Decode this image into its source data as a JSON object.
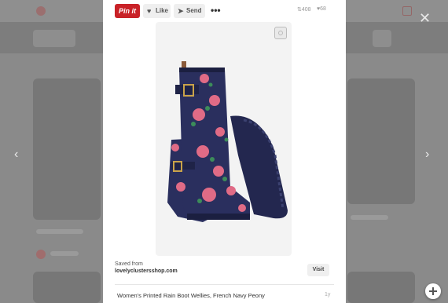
{
  "toolbar": {
    "pin_label": "Pin it",
    "like_label": "Like",
    "send_label": "Send",
    "more_label": "•••",
    "repin_count": "408",
    "like_count": "68"
  },
  "pin": {
    "saved_from_label": "Saved from",
    "domain": "lovelyclustersshop.com",
    "visit_label": "Visit",
    "description": "Women's Printed Rain Boot Wellies, French Navy Peony",
    "age": "1y"
  },
  "colors": {
    "pin_red": "#c92228",
    "boot_navy": "#2a2f5e",
    "flower_pink": "#e06b86"
  },
  "icons": [
    "pinterest-logo",
    "heart-icon",
    "send-icon",
    "more-icon",
    "repin-icon",
    "visual-search-icon",
    "close-icon",
    "chevron-left-icon",
    "chevron-right-icon",
    "plus-icon"
  ]
}
